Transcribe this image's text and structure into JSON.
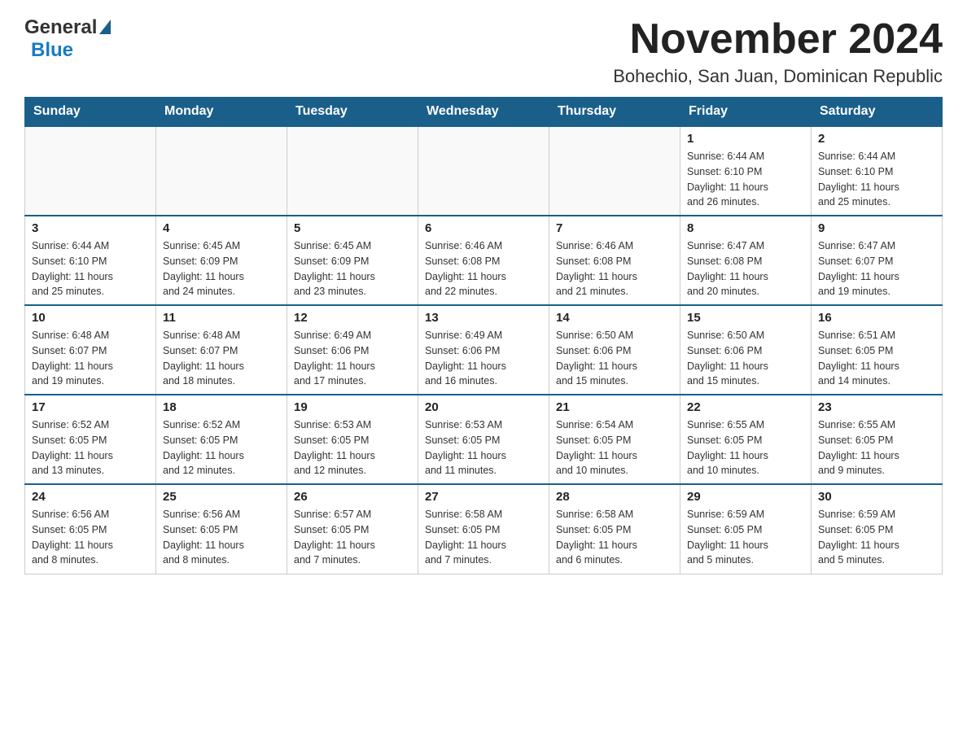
{
  "header": {
    "logo_general": "General",
    "logo_blue": "Blue",
    "month_title": "November 2024",
    "location": "Bohechio, San Juan, Dominican Republic"
  },
  "weekdays": [
    "Sunday",
    "Monday",
    "Tuesday",
    "Wednesday",
    "Thursday",
    "Friday",
    "Saturday"
  ],
  "weeks": [
    {
      "days": [
        {
          "number": "",
          "info": ""
        },
        {
          "number": "",
          "info": ""
        },
        {
          "number": "",
          "info": ""
        },
        {
          "number": "",
          "info": ""
        },
        {
          "number": "",
          "info": ""
        },
        {
          "number": "1",
          "info": "Sunrise: 6:44 AM\nSunset: 6:10 PM\nDaylight: 11 hours\nand 26 minutes."
        },
        {
          "number": "2",
          "info": "Sunrise: 6:44 AM\nSunset: 6:10 PM\nDaylight: 11 hours\nand 25 minutes."
        }
      ]
    },
    {
      "days": [
        {
          "number": "3",
          "info": "Sunrise: 6:44 AM\nSunset: 6:10 PM\nDaylight: 11 hours\nand 25 minutes."
        },
        {
          "number": "4",
          "info": "Sunrise: 6:45 AM\nSunset: 6:09 PM\nDaylight: 11 hours\nand 24 minutes."
        },
        {
          "number": "5",
          "info": "Sunrise: 6:45 AM\nSunset: 6:09 PM\nDaylight: 11 hours\nand 23 minutes."
        },
        {
          "number": "6",
          "info": "Sunrise: 6:46 AM\nSunset: 6:08 PM\nDaylight: 11 hours\nand 22 minutes."
        },
        {
          "number": "7",
          "info": "Sunrise: 6:46 AM\nSunset: 6:08 PM\nDaylight: 11 hours\nand 21 minutes."
        },
        {
          "number": "8",
          "info": "Sunrise: 6:47 AM\nSunset: 6:08 PM\nDaylight: 11 hours\nand 20 minutes."
        },
        {
          "number": "9",
          "info": "Sunrise: 6:47 AM\nSunset: 6:07 PM\nDaylight: 11 hours\nand 19 minutes."
        }
      ]
    },
    {
      "days": [
        {
          "number": "10",
          "info": "Sunrise: 6:48 AM\nSunset: 6:07 PM\nDaylight: 11 hours\nand 19 minutes."
        },
        {
          "number": "11",
          "info": "Sunrise: 6:48 AM\nSunset: 6:07 PM\nDaylight: 11 hours\nand 18 minutes."
        },
        {
          "number": "12",
          "info": "Sunrise: 6:49 AM\nSunset: 6:06 PM\nDaylight: 11 hours\nand 17 minutes."
        },
        {
          "number": "13",
          "info": "Sunrise: 6:49 AM\nSunset: 6:06 PM\nDaylight: 11 hours\nand 16 minutes."
        },
        {
          "number": "14",
          "info": "Sunrise: 6:50 AM\nSunset: 6:06 PM\nDaylight: 11 hours\nand 15 minutes."
        },
        {
          "number": "15",
          "info": "Sunrise: 6:50 AM\nSunset: 6:06 PM\nDaylight: 11 hours\nand 15 minutes."
        },
        {
          "number": "16",
          "info": "Sunrise: 6:51 AM\nSunset: 6:05 PM\nDaylight: 11 hours\nand 14 minutes."
        }
      ]
    },
    {
      "days": [
        {
          "number": "17",
          "info": "Sunrise: 6:52 AM\nSunset: 6:05 PM\nDaylight: 11 hours\nand 13 minutes."
        },
        {
          "number": "18",
          "info": "Sunrise: 6:52 AM\nSunset: 6:05 PM\nDaylight: 11 hours\nand 12 minutes."
        },
        {
          "number": "19",
          "info": "Sunrise: 6:53 AM\nSunset: 6:05 PM\nDaylight: 11 hours\nand 12 minutes."
        },
        {
          "number": "20",
          "info": "Sunrise: 6:53 AM\nSunset: 6:05 PM\nDaylight: 11 hours\nand 11 minutes."
        },
        {
          "number": "21",
          "info": "Sunrise: 6:54 AM\nSunset: 6:05 PM\nDaylight: 11 hours\nand 10 minutes."
        },
        {
          "number": "22",
          "info": "Sunrise: 6:55 AM\nSunset: 6:05 PM\nDaylight: 11 hours\nand 10 minutes."
        },
        {
          "number": "23",
          "info": "Sunrise: 6:55 AM\nSunset: 6:05 PM\nDaylight: 11 hours\nand 9 minutes."
        }
      ]
    },
    {
      "days": [
        {
          "number": "24",
          "info": "Sunrise: 6:56 AM\nSunset: 6:05 PM\nDaylight: 11 hours\nand 8 minutes."
        },
        {
          "number": "25",
          "info": "Sunrise: 6:56 AM\nSunset: 6:05 PM\nDaylight: 11 hours\nand 8 minutes."
        },
        {
          "number": "26",
          "info": "Sunrise: 6:57 AM\nSunset: 6:05 PM\nDaylight: 11 hours\nand 7 minutes."
        },
        {
          "number": "27",
          "info": "Sunrise: 6:58 AM\nSunset: 6:05 PM\nDaylight: 11 hours\nand 7 minutes."
        },
        {
          "number": "28",
          "info": "Sunrise: 6:58 AM\nSunset: 6:05 PM\nDaylight: 11 hours\nand 6 minutes."
        },
        {
          "number": "29",
          "info": "Sunrise: 6:59 AM\nSunset: 6:05 PM\nDaylight: 11 hours\nand 5 minutes."
        },
        {
          "number": "30",
          "info": "Sunrise: 6:59 AM\nSunset: 6:05 PM\nDaylight: 11 hours\nand 5 minutes."
        }
      ]
    }
  ]
}
